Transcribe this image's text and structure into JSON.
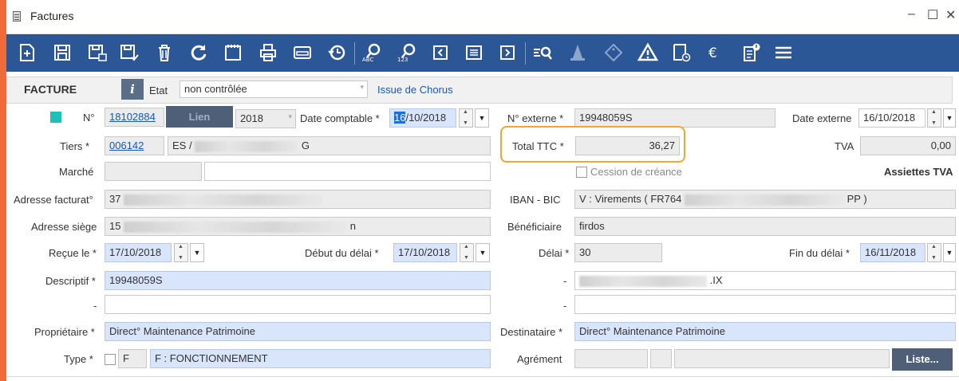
{
  "window": {
    "title": "Factures",
    "minimize": "–",
    "maximize": "☐",
    "close": "✕"
  },
  "header": {
    "section_title": "FACTURE",
    "info_label": "i",
    "etat_label": "Etat",
    "etat_value": "non contrôlée",
    "issue_link": "Issue de Chorus"
  },
  "row1": {
    "num_label": "N°",
    "num_value": "18102884",
    "lien_label": "Lien",
    "year_value": "2018",
    "date_comptable_label": "Date comptable *",
    "date_comptable_day": "16",
    "date_comptable_rest": "/10/2018",
    "num_externe_label": "N° externe *",
    "num_externe_value": "19948059S",
    "date_externe_label": "Date externe",
    "date_externe_value": "16/10/2018"
  },
  "row2": {
    "tiers_label": "Tiers *",
    "tiers_code": "006142",
    "tiers_name_start": "ES /",
    "tiers_name_end": "G",
    "total_ttc_label": "Total TTC *",
    "total_ttc_value": "36,27",
    "tva_label": "TVA",
    "tva_value": "0,00"
  },
  "row3": {
    "marche_label": "Marché",
    "cession_label": "Cession de créance",
    "assiettes_label": "Assiettes TVA"
  },
  "row4": {
    "adresse_fact_label": "Adresse facturat°",
    "adresse_fact_value": "37",
    "iban_label": "IBAN - BIC",
    "iban_start": "V : Virements ( FR764",
    "iban_end": "PP )"
  },
  "row5": {
    "adresse_siege_label": "Adresse siège",
    "adresse_siege_start": "15",
    "adresse_siege_end": "n",
    "beneficiaire_label": "Bénéficiaire",
    "beneficiaire_value": "firdos"
  },
  "row6": {
    "recue_label": "Reçue le *",
    "recue_value": "17/10/2018",
    "debut_delai_label": "Début du délai *",
    "debut_delai_value": "17/10/2018",
    "delai_label": "Délai *",
    "delai_value": "30",
    "fin_delai_label": "Fin du délai *",
    "fin_delai_value": "16/11/2018"
  },
  "row7": {
    "descriptif_label": "Descriptif *",
    "descriptif_value": "19948059S",
    "dash": "-",
    "right_value_end": ".IX"
  },
  "row8": {
    "dash": "-"
  },
  "row9": {
    "proprietaire_label": "Propriétaire *",
    "proprietaire_value": "Direct° Maintenance Patrimoine",
    "destinataire_label": "Destinataire *",
    "destinataire_value": "Direct° Maintenance Patrimoine"
  },
  "row10": {
    "type_label": "Type *",
    "type_code": "F",
    "type_value": "F : FONCTIONNEMENT",
    "agrement_label": "Agrément",
    "liste_label": "Liste..."
  },
  "colors": {
    "toolbar": "#2b5797",
    "accent_strip": "#f06a3a",
    "highlight": "#f3a533",
    "required_field": "#d9e5fb",
    "status_square": "#1cc2b7"
  }
}
